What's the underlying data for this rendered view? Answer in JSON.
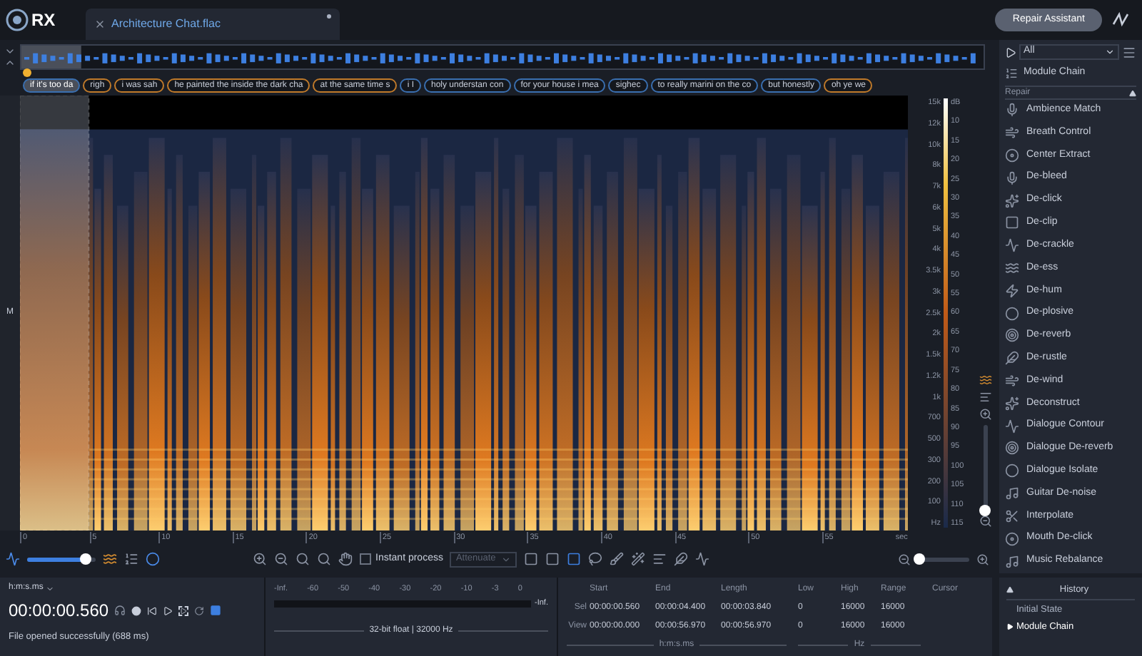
{
  "app": {
    "logo": "RX"
  },
  "file_tab": {
    "title": "Architecture Chat.flac"
  },
  "repair_assistant": "Repair Assistant",
  "transcript": [
    {
      "text": "if it's too da",
      "color": "#3a6fb0",
      "selected": true
    },
    {
      "text": "righ",
      "color": "#c07a2a",
      "selected": false
    },
    {
      "text": "i was sah",
      "color": "#c07a2a",
      "selected": false
    },
    {
      "text": "he painted the inside the dark cha",
      "color": "#c07a2a",
      "selected": false
    },
    {
      "text": "at the same time s",
      "color": "#c07a2a",
      "selected": false
    },
    {
      "text": "i I",
      "color": "#3a6fb0",
      "selected": false
    },
    {
      "text": "holy understan con",
      "color": "#3a6fb0",
      "selected": false
    },
    {
      "text": "for your house i mea",
      "color": "#3a6fb0",
      "selected": false
    },
    {
      "text": "sighec",
      "color": "#3a6fb0",
      "selected": false
    },
    {
      "text": "to really marini on the co",
      "color": "#3a6fb0",
      "selected": false
    },
    {
      "text": "but honestly",
      "color": "#3a6fb0",
      "selected": false
    },
    {
      "text": "oh ye we",
      "color": "#c07a2a",
      "selected": false
    }
  ],
  "channel_label": "M",
  "frequency_ticks": [
    "15k",
    "12k",
    "10k",
    "8k",
    "7k",
    "6k",
    "5k",
    "4k",
    "3.5k",
    "3k",
    "2.5k",
    "2k",
    "1.5k",
    "1.2k",
    "1k",
    "700",
    "500",
    "300",
    "200",
    "100"
  ],
  "frequency_unit": "Hz",
  "db_ticks": [
    "dB",
    "10",
    "15",
    "20",
    "25",
    "30",
    "35",
    "40",
    "45",
    "50",
    "55",
    "60",
    "65",
    "70",
    "75",
    "80",
    "85",
    "90",
    "95",
    "100",
    "105",
    "110",
    "115"
  ],
  "time_ticks": [
    "0",
    "5",
    "10",
    "15",
    "20",
    "25",
    "30",
    "35",
    "40",
    "45",
    "50",
    "55"
  ],
  "time_unit": "sec",
  "vertical_zoom": {
    "level": 0.0
  },
  "toolbar": {
    "zoom_slider": {
      "level": 0.85
    },
    "instant_process": {
      "label": "Instant process",
      "checked": false
    },
    "attenuate": {
      "value": "Attenuate",
      "disabled": true
    },
    "horizontal_zoom": {
      "level": 0.04
    }
  },
  "transport": {
    "time_format": "h:m:s.ms",
    "timecode": "00:00:00.560",
    "status": "File opened successfully (688 ms)"
  },
  "meter": {
    "ticks": [
      "-Inf.",
      "-60",
      "-50",
      "-40",
      "-30",
      "-20",
      "-10",
      "-3",
      "0"
    ],
    "end_label": "-Inf.",
    "format": "32-bit float | 32000 Hz"
  },
  "selection": {
    "time_columns": [
      "Start",
      "End",
      "Length"
    ],
    "freq_columns": [
      "Low",
      "High",
      "Range"
    ],
    "cursor_label": "Cursor",
    "rows": [
      {
        "label": "Sel",
        "times": [
          "00:00:00.560",
          "00:00:04.400",
          "00:00:03.840"
        ],
        "freqs": [
          "0",
          "16000",
          "16000"
        ]
      },
      {
        "label": "View",
        "times": [
          "00:00:00.000",
          "00:00:56.970",
          "00:00:56.970"
        ],
        "freqs": [
          "0",
          "16000",
          "16000"
        ]
      }
    ],
    "time_unit": "h:m:s.ms",
    "freq_unit": "Hz"
  },
  "modules": {
    "filter": "All",
    "chain": "Module Chain",
    "section": "Repair",
    "items": [
      "Ambience Match",
      "Breath Control",
      "Center Extract",
      "De-bleed",
      "De-click",
      "De-clip",
      "De-crackle",
      "De-ess",
      "De-hum",
      "De-plosive",
      "De-reverb",
      "De-rustle",
      "De-wind",
      "Deconstruct",
      "Dialogue Contour",
      "Dialogue De-reverb",
      "Dialogue Isolate",
      "Guitar De-noise",
      "Interpolate",
      "Mouth De-click",
      "Music Rebalance"
    ]
  },
  "history": {
    "title": "History",
    "items": [
      {
        "text": "Initial State",
        "current": false
      },
      {
        "text": "Module Chain",
        "current": true
      }
    ]
  }
}
